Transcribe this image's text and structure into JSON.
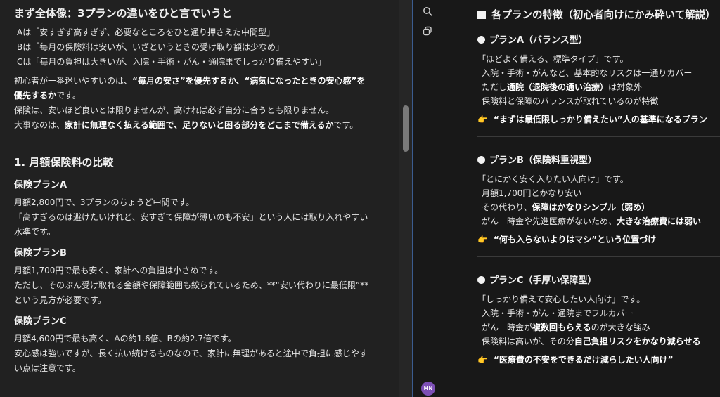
{
  "left": {
    "summary_heading": "まず全体像：3プランの違いをひと言でいうと",
    "summary_lines": [
      "Aは「安すぎず高すぎず、必要なところをひと通り押さえた中間型」",
      "Bは「毎月の保険料は安いが、いざというときの受け取り額は少なめ」",
      "Cは「毎月の負担は大きいが、入院・手術・がん・通院までしっかり備えやすい」"
    ],
    "summary_letters": [
      "A",
      "B",
      "C"
    ],
    "para1_pre": "初心者が一番迷いやすいのは、",
    "para1_b1": "“毎月の安さ”を優先するか、“病気になったときの安心感”を優先するか",
    "para1_post": "です。",
    "para2": "保険は、安いほど良いとは限りませんが、高ければ必ず自分に合うとも限りません。",
    "para3_pre": "大事なのは、",
    "para3_b": "家計に無理なく払える範囲で、足りないと困る部分をどこまで備えるか",
    "para3_post": "です。",
    "section_heading": "1. 月額保険料の比較",
    "plans": [
      {
        "title": "保険プランA",
        "lines": [
          "月額2,800円で、3プランのちょうど中間です。",
          "「高すぎるのは避けたいけれど、安すぎて保障が薄いのも不安」という人には取り入れやすい水準です。"
        ]
      },
      {
        "title": "保険プランB",
        "lines": [
          "月額1,700円で最も安く、家計への負担は小さめです。",
          "ただし、そのぶん受け取れる金額や保障範囲も絞られているため、**“安い代わりに最低限”**という見方が必要です。"
        ]
      },
      {
        "title": "保険プランC",
        "lines": [
          "月額4,600円で最も高く、Aの約1.6倍、Bの約2.7倍です。",
          "安心感は強いですが、長く払い続けるものなので、家計に無理があると途中で負担に感じやすい点は注意です。"
        ]
      }
    ]
  },
  "rail": {
    "search_icon": "search-icon",
    "copy_icon": "copy-icon",
    "avatar_initials": "MN"
  },
  "canvas": {
    "heading": "各プランの特徴（初心者向けにかみ砕いて解説）",
    "planA": {
      "title": "プランA（バランス型）",
      "tagline": "「ほどよく備える、標準タイプ」です。",
      "l1": "入院・手術・がんなど、基本的なリスクは一通りカバー",
      "l2_pre": "ただし",
      "l2_b": "通院（退院後の通い治療）",
      "l2_post": "は対象外",
      "l3": "保険料と保障のバランスが取れているのが特徴",
      "point": "“まずは最低限しっかり備えたい”人の基準になるプラン"
    },
    "planB": {
      "title": "プランB（保険料重視型）",
      "tagline": "「とにかく安く入りたい人向け」です。",
      "l1": "月額1,700円とかなり安い",
      "l2_pre": "その代わり、",
      "l2_b": "保障はかなりシンプル（弱め）",
      "l3_pre": "がん一時金や先進医療がないため、",
      "l3_b": "大きな治療費には弱い",
      "point": "“何も入らないよりはマシ”という位置づけ"
    },
    "planC": {
      "title": "プランC（手厚い保障型）",
      "tagline": "「しっかり備えて安心したい人向け」です。",
      "l1": "入院・手術・がん・通院までフルカバー",
      "l2_pre": "がん一時金が",
      "l2_b": "複数回もらえる",
      "l2_post": "のが大きな強み",
      "l3_pre": "保険料は高いが、その分",
      "l3_b": "自己負担リスクをかなり減らせる",
      "point": "“医療費の不安をできるだけ減らしたい人向け”"
    }
  },
  "colors": {
    "background": "#212121",
    "canvas_background": "#181818",
    "divider": "#3b5c8f",
    "avatar": "#7c4fb5",
    "hand_emoji": "#f5c542"
  }
}
